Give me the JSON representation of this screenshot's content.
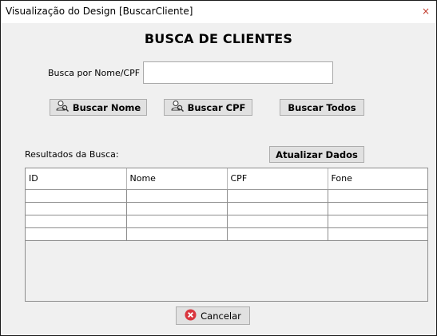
{
  "window": {
    "title": "Visualização do Design [BuscarCliente]",
    "close_glyph": "×"
  },
  "form": {
    "heading": "BUSCA DE CLIENTES",
    "search_label": "Busca por Nome/CPF",
    "search_value": "",
    "search_placeholder": ""
  },
  "buttons": {
    "buscar_nome": "Buscar Nome",
    "buscar_cpf": "Buscar CPF",
    "buscar_todos": "Buscar Todos",
    "atualizar": "Atualizar Dados",
    "cancelar": "Cancelar"
  },
  "results": {
    "label": "Resultados da Busca:",
    "columns": [
      "ID",
      "Nome",
      "CPF",
      "Fone"
    ],
    "rows": [
      [
        "",
        "",
        "",
        ""
      ],
      [
        "",
        "",
        "",
        ""
      ],
      [
        "",
        "",
        "",
        ""
      ],
      [
        "",
        "",
        "",
        ""
      ]
    ]
  },
  "icons": {
    "search_user": "user-search-icon",
    "cancel": "cancel-icon"
  },
  "colors": {
    "cancel_icon": "#d9363e",
    "window_bg": "#f0f0f0",
    "button_bg": "#e1e1e1"
  }
}
